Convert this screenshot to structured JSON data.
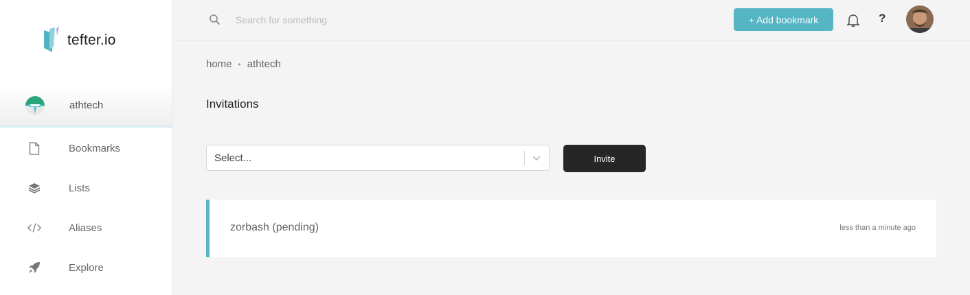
{
  "app": {
    "name": "tefter.io"
  },
  "sidebar": {
    "team": {
      "name": "athtech"
    },
    "items": [
      {
        "label": "Bookmarks",
        "icon": "file-icon"
      },
      {
        "label": "Lists",
        "icon": "layers-icon"
      },
      {
        "label": "Aliases",
        "icon": "code-icon"
      },
      {
        "label": "Explore",
        "icon": "rocket-icon"
      }
    ]
  },
  "topbar": {
    "search_placeholder": "Search for something",
    "add_bookmark_label": "+ Add bookmark",
    "help_label": "?"
  },
  "breadcrumb": [
    "home",
    "athtech"
  ],
  "page": {
    "title": "Invitations",
    "select_placeholder": "Select...",
    "invite_label": "Invite"
  },
  "invitations": [
    {
      "name": "zorbash (pending)",
      "time": "less than a minute ago"
    }
  ],
  "colors": {
    "accent": "#55b5c2",
    "dark_button": "#262626",
    "background": "#f4f4f4"
  }
}
